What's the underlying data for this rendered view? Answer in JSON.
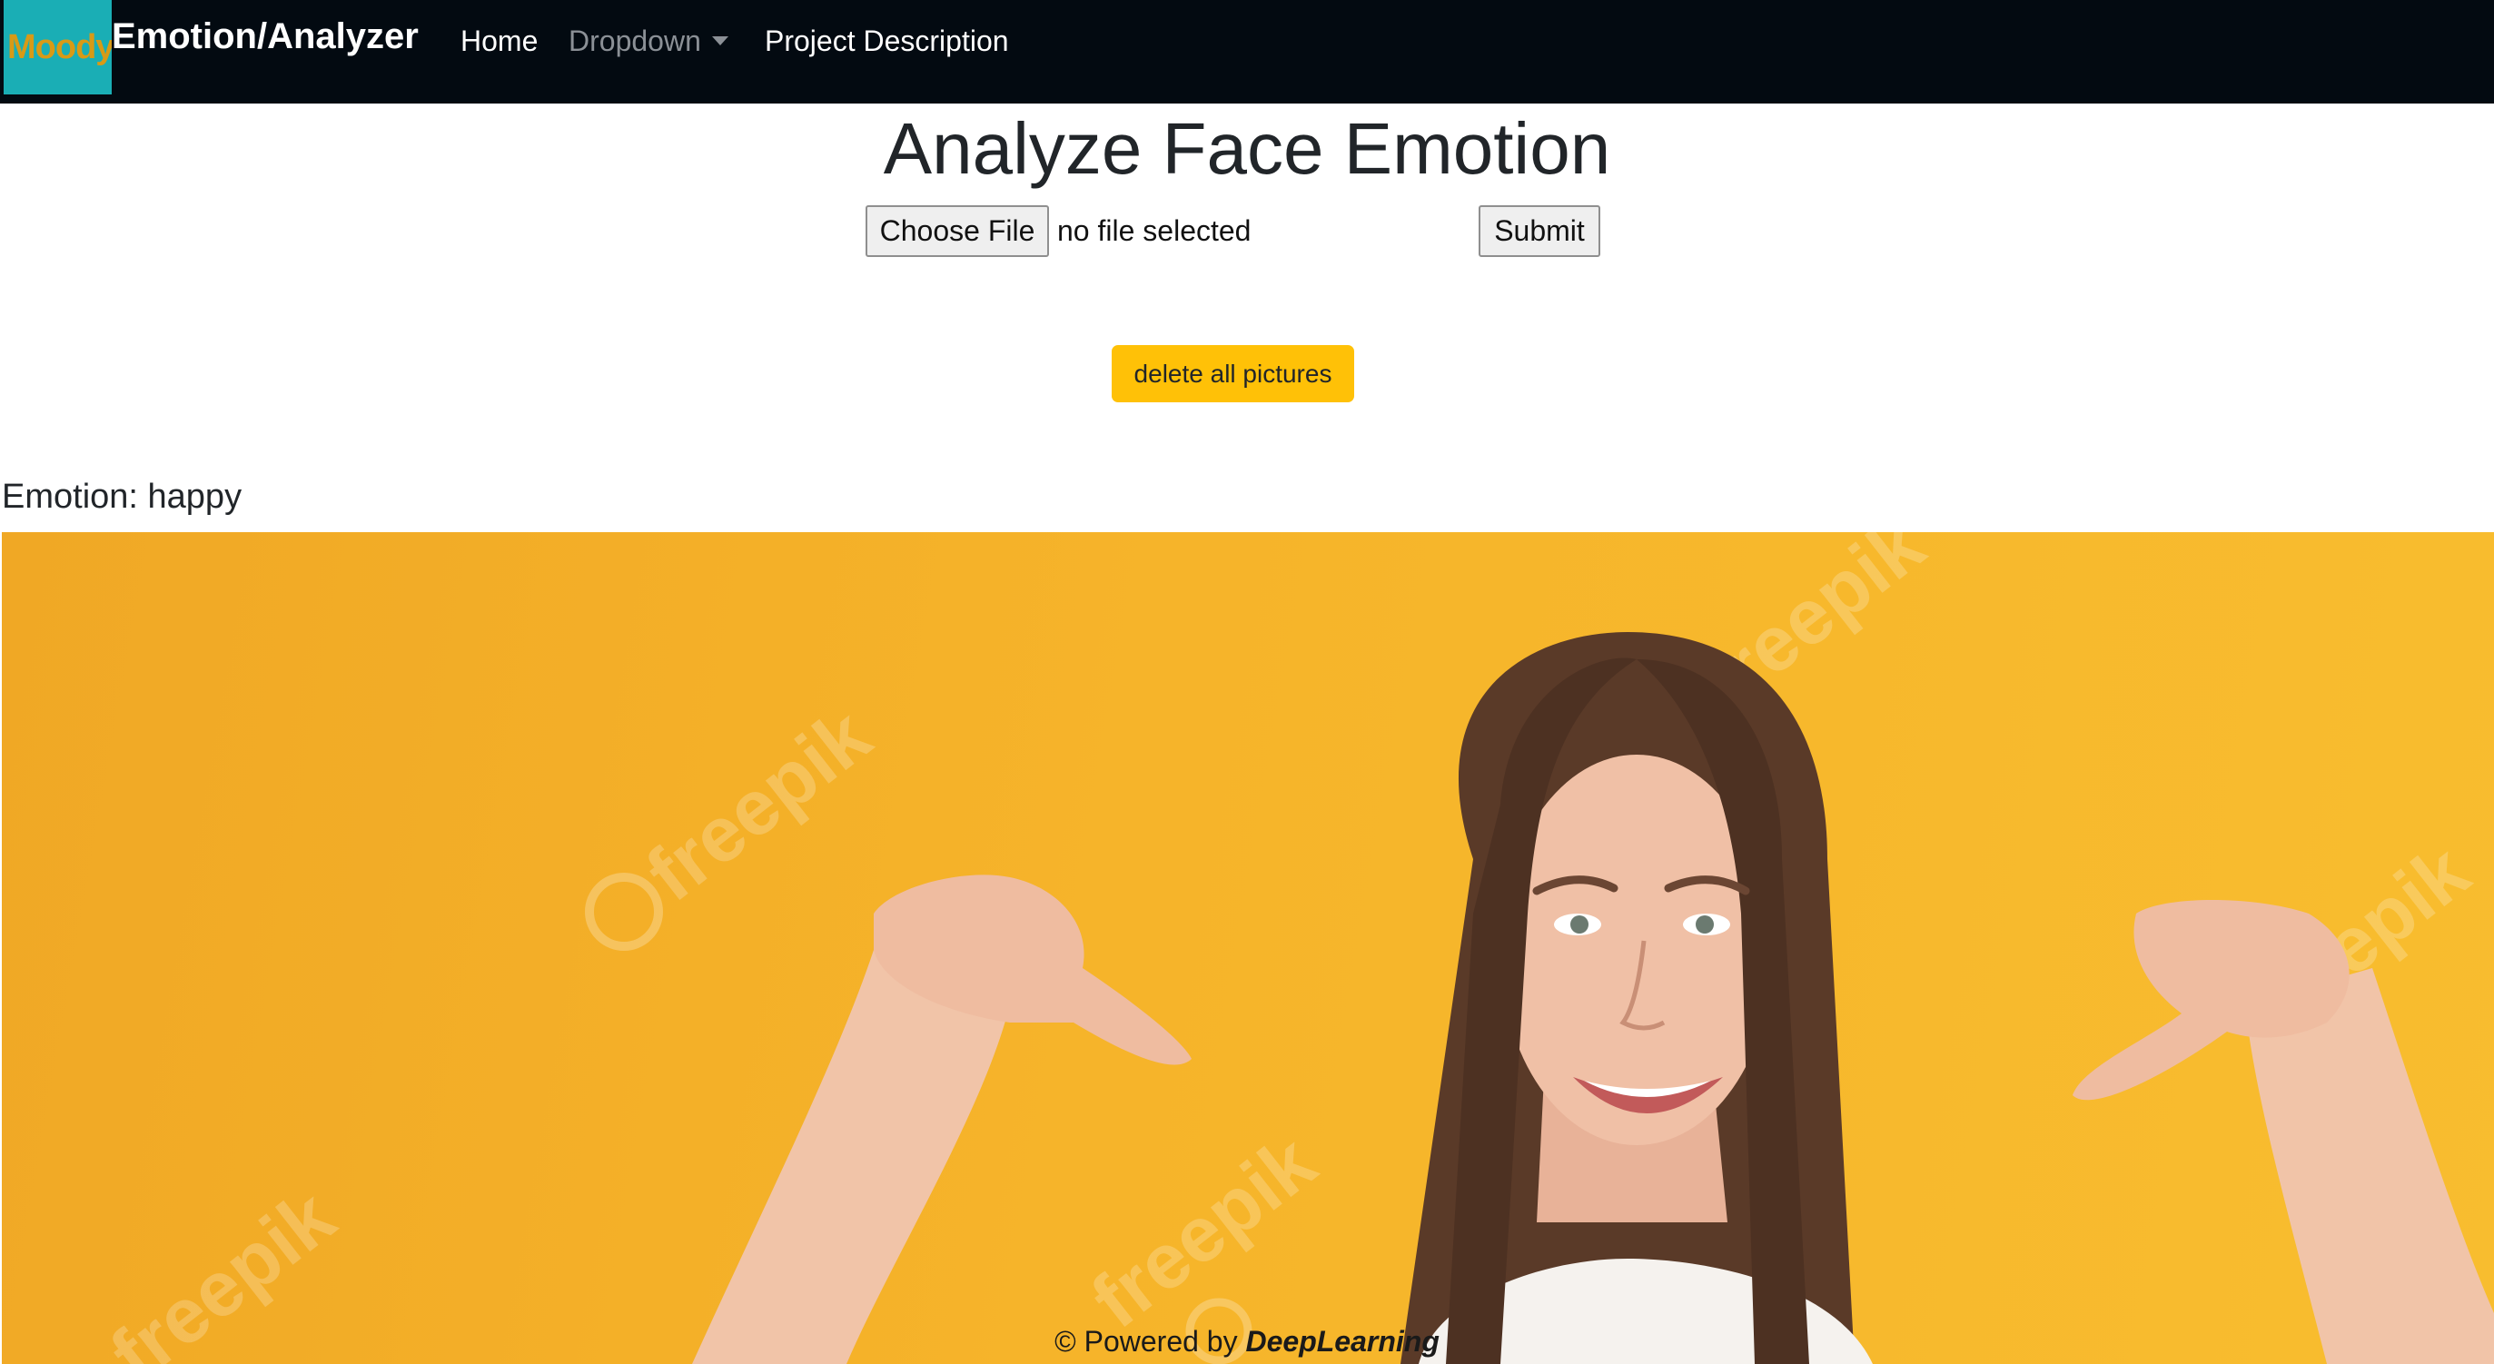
{
  "navbar": {
    "logo_text": "Moody",
    "brand": "Emotion/Analyzer",
    "links": [
      {
        "label": "Home"
      },
      {
        "label": "Dropdown"
      },
      {
        "label": "Project Description"
      }
    ]
  },
  "main": {
    "title": "Analyze Face Emotion",
    "file_input": {
      "button_label": "Choose File",
      "status": "no file selected"
    },
    "submit_label": "Submit",
    "delete_label": "delete all pictures",
    "emotion_label": "Emotion:",
    "emotion_value": "happy"
  },
  "photo": {
    "watermark": "freepik"
  },
  "footer": {
    "prefix": "© Powered by",
    "brand": "DeepLearning"
  },
  "colors": {
    "navbar_bg": "#030a11",
    "logo_bg": "#1aaeb5",
    "logo_text": "#d89a16",
    "warning_button": "#ffc107",
    "photo_bg": "#f6b42a"
  }
}
